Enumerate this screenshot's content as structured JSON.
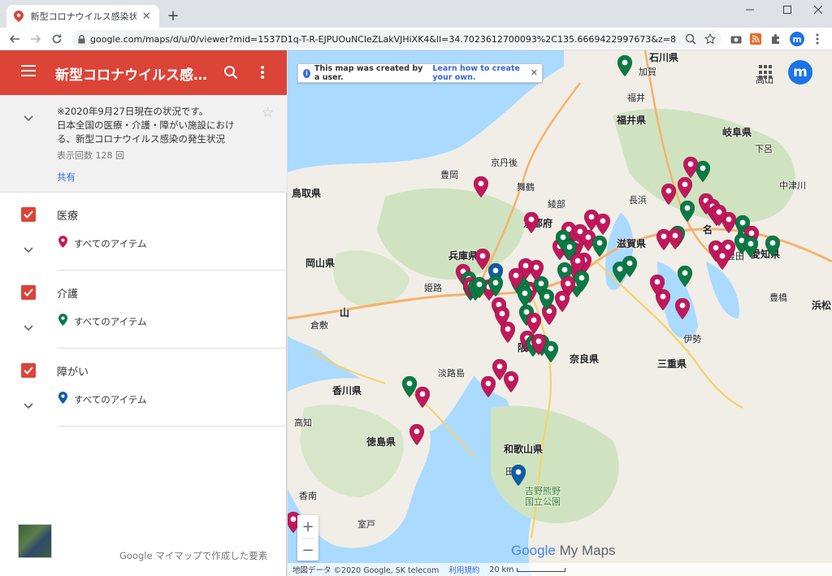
{
  "browser": {
    "tab_title": "新型コロナウイルス感染状況（医療",
    "url": "google.com/maps/d/u/0/viewer?mid=1537D1q-T-R-EJPUOuNCleZLakVJHiXK4&ll=34.7023612700093%2C135.6669422997673&z=8",
    "profile_initial": "m"
  },
  "panel": {
    "map_title": "新型コロナウイルス感…",
    "description_lines": [
      "※2020年9月27日現在の状況です。",
      "日本全国の医療・介護・障がい施設におけ",
      "る、新型コロナウイルス感染の発生状況"
    ],
    "views": "表示回数 128 回",
    "share": "共有",
    "layers": [
      {
        "name": "医療",
        "item": "すべてのアイテム",
        "pin_color": "#c2185b"
      },
      {
        "name": "介護",
        "item": "すべてのアイテム",
        "pin_color": "#0b7a45"
      },
      {
        "name": "障がい",
        "item": "すべてのアイテム",
        "pin_color": "#0d5ca8"
      }
    ],
    "footer": "Google マイマップで作成した要素"
  },
  "map": {
    "info_text": "This map was created by a user.",
    "info_link": "Learn how to create your own.",
    "avatar_initial": "m",
    "zoom_in": "+",
    "zoom_out": "−",
    "logo_google": "Google",
    "logo_mymaps": "My Maps",
    "attribution": "地図データ ©2020 Google, SK telecom",
    "terms": "利用規約",
    "scale": "20 km",
    "labels": {
      "ishikawa": "石川県",
      "kaga": "加賀",
      "fukui_pref": "福井県",
      "fukui": "福井",
      "gifu_pref": "岐阜県",
      "gero": "下呂",
      "takayama": "高山",
      "nakatsugawa": "中津川",
      "tottori": "鳥取県",
      "kyotango": "京丹後",
      "toyooka": "豊岡",
      "maizuru": "舞鶴",
      "nagahama": "長浜",
      "kyoto_pref": "京都府",
      "ayabe": "綾部",
      "shiga": "滋賀県",
      "hyogo": "兵庫県",
      "okayama_pref": "岡山県",
      "himeji": "姫路",
      "kurashiki": "倉敷",
      "okayama_city": "山",
      "nagoya": "名",
      "aichi": "愛知県",
      "toyota": "豊田",
      "toyohashi": "豊橋",
      "hamamatsu": "浜松",
      "ise": "伊勢",
      "mie": "三重県",
      "nara": "奈良県",
      "osaka": "阪",
      "awaji": "淡路島",
      "kagawa": "香川県",
      "tokushima": "徳島県",
      "wakayama": "和歌山県",
      "tanabe": "田辺",
      "yoshino_kumano": "吉野熊野",
      "kokuritsu": "国立公園",
      "kochi": "高知",
      "konan": "香南",
      "muroto": "室戸"
    },
    "pins": [
      {
        "t": "iryo"
      },
      {
        "t": "kaigo"
      },
      {
        "t": "iryo"
      },
      {
        "t": "kaigo"
      },
      {
        "t": "iryo"
      },
      {
        "t": "iryo"
      },
      {
        "t": "iryo"
      },
      {
        "t": "kaigo"
      },
      {
        "t": "iryo"
      },
      {
        "t": "iryo"
      },
      {
        "t": "kaigo"
      },
      {
        "t": "iryo"
      },
      {
        "t": "iryo"
      },
      {
        "t": "iryo"
      },
      {
        "t": "kaigo"
      },
      {
        "t": "iryo"
      },
      {
        "t": "kaigo"
      },
      {
        "t": "iryo"
      },
      {
        "t": "kaigo"
      },
      {
        "t": "kaigo"
      },
      {
        "t": "iryo"
      },
      {
        "t": "kaigo"
      },
      {
        "t": "iryo"
      },
      {
        "t": "iryo"
      },
      {
        "t": "kaigo"
      },
      {
        "t": "iryo"
      },
      {
        "t": "iryo"
      },
      {
        "t": "iryo"
      },
      {
        "t": "iryo"
      },
      {
        "t": "kaigo"
      },
      {
        "t": "kaigo"
      },
      {
        "t": "iryo"
      },
      {
        "t": "iryo"
      },
      {
        "t": "iryo"
      },
      {
        "t": "iryo"
      },
      {
        "t": "iryo"
      },
      {
        "t": "iryo"
      },
      {
        "t": "iryo"
      },
      {
        "t": "kaigo"
      },
      {
        "t": "iryo"
      },
      {
        "t": "iryo"
      },
      {
        "t": "kaigo"
      },
      {
        "t": "iryo"
      },
      {
        "t": "iryo"
      },
      {
        "t": "kaigo"
      },
      {
        "t": "iryo"
      },
      {
        "t": "iryo"
      },
      {
        "t": "shogai"
      },
      {
        "t": "iryo"
      },
      {
        "t": "kaigo"
      },
      {
        "t": "iryo"
      },
      {
        "t": "kaigo"
      },
      {
        "t": "kaigo"
      },
      {
        "t": "iryo"
      },
      {
        "t": "iryo"
      },
      {
        "t": "kaigo"
      },
      {
        "t": "kaigo"
      },
      {
        "t": "kaigo"
      },
      {
        "t": "iryo"
      },
      {
        "t": "iryo"
      },
      {
        "t": "kaigo"
      },
      {
        "t": "iryo"
      },
      {
        "t": "kaigo"
      },
      {
        "t": "iryo"
      },
      {
        "t": "kaigo"
      },
      {
        "t": "kaigo"
      },
      {
        "t": "kaigo"
      },
      {
        "t": "iryo"
      },
      {
        "t": "iryo"
      },
      {
        "t": "iryo"
      },
      {
        "t": "iryo"
      },
      {
        "t": "kaigo"
      },
      {
        "t": "kaigo"
      },
      {
        "t": "iryo"
      },
      {
        "t": "kaigo"
      },
      {
        "t": "iryo"
      },
      {
        "t": "iryo"
      },
      {
        "t": "iryo"
      },
      {
        "t": "iryo"
      },
      {
        "t": "kaigo"
      },
      {
        "t": "kaigo"
      },
      {
        "t": "iryo"
      },
      {
        "t": "kaigo"
      },
      {
        "t": "iryo"
      },
      {
        "t": "iryo"
      },
      {
        "t": "kaigo"
      },
      {
        "t": "iryo"
      },
      {
        "t": "iryo"
      },
      {
        "t": "shogai"
      },
      {
        "t": "iryo"
      }
    ]
  },
  "colors": {
    "iryo": "#c2185b",
    "kaigo": "#0b7a45",
    "shogai": "#0d5ca8",
    "header": "#db4437"
  }
}
